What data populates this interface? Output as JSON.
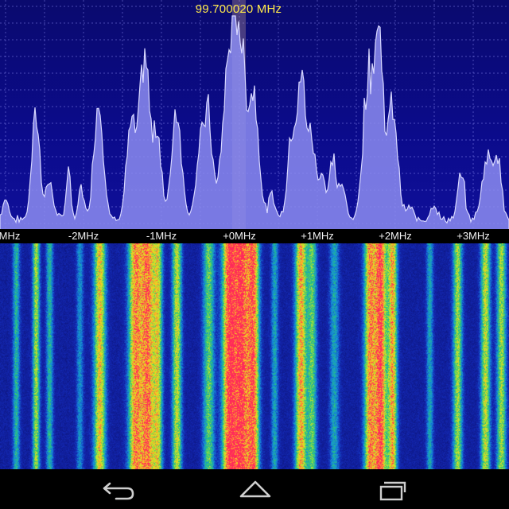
{
  "header": {
    "frequency": "99.700020 MHz"
  },
  "axis": {
    "ticks": [
      "MHz",
      "-2MHz",
      "-1MHz",
      "+0MHz",
      "+1MHz",
      "+2MHz",
      "+3MHz"
    ]
  },
  "navbar": {
    "buttons": [
      {
        "name": "back-button",
        "icon": "back-arrow-icon"
      },
      {
        "name": "home-button",
        "icon": "home-icon"
      },
      {
        "name": "recent-apps-button",
        "icon": "recent-apps-icon"
      }
    ]
  },
  "colors": {
    "spectrum_bg": "#0b0b8c",
    "spectrum_fill": "#8c8cf0",
    "spectrum_line": "#d8d8ff",
    "grid": "#9a9aff",
    "tuning_marker": "#e8c0a0",
    "freq_text": "#ffe94a",
    "waterfall_bg": "#0a0f6e",
    "navbar_icons": "#cfcfcf"
  }
}
